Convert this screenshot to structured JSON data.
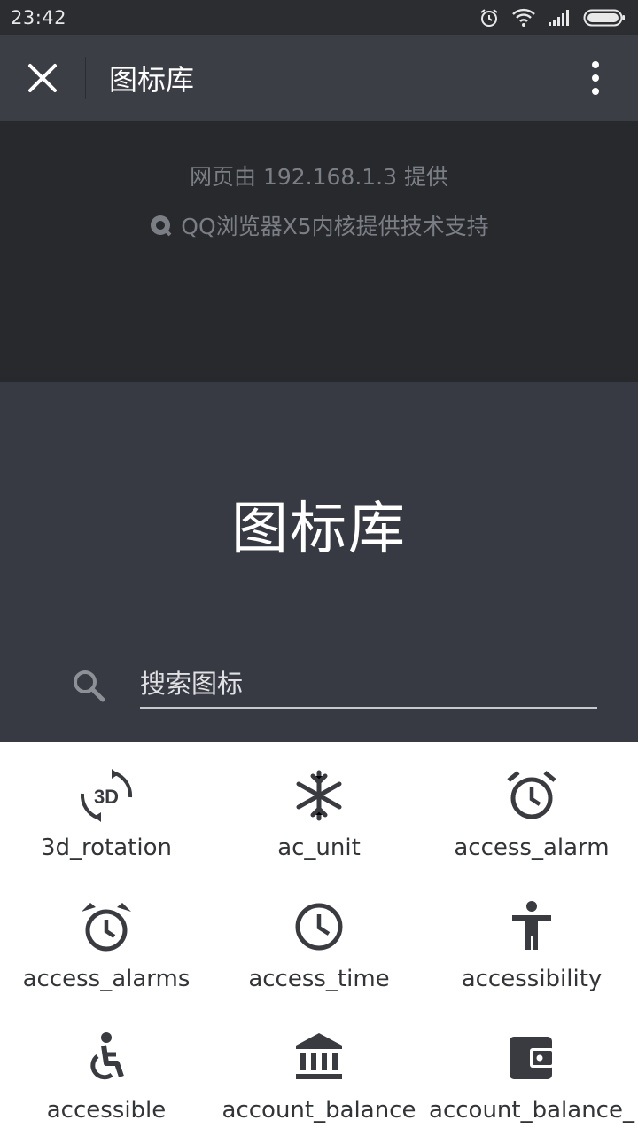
{
  "status_bar": {
    "time": "23:42",
    "icons": [
      "alarm-icon",
      "wifi-icon",
      "signal-icon",
      "battery-icon"
    ]
  },
  "title_bar": {
    "title": "图标库",
    "close_icon": "close-icon",
    "more_icon": "more-vert-icon"
  },
  "provider": {
    "line1": "网页由 192.168.1.3 提供",
    "line2": "QQ浏览器X5内核提供技术支持"
  },
  "hero": {
    "title": "图标库",
    "search_placeholder": "搜索图标",
    "search_value": ""
  },
  "icons": [
    {
      "name": "3d_rotation",
      "icon": "3d-rotation-icon"
    },
    {
      "name": "ac_unit",
      "icon": "ac-unit-icon"
    },
    {
      "name": "access_alarm",
      "icon": "access-alarm-icon"
    },
    {
      "name": "access_alarms",
      "icon": "access-alarms-icon"
    },
    {
      "name": "access_time",
      "icon": "access-time-icon"
    },
    {
      "name": "accessibility",
      "icon": "accessibility-icon"
    },
    {
      "name": "accessible",
      "icon": "accessible-icon"
    },
    {
      "name": "account_balance",
      "icon": "account-balance-icon"
    },
    {
      "name": "account_balance_",
      "icon": "account-balance-wallet-icon"
    }
  ],
  "colors": {
    "status_bar": "#2b2d31",
    "title_bar": "#3c3e45",
    "provider_bg": "#27292d",
    "hero_bg": "#373943",
    "icon_color": "#3a3b40"
  }
}
